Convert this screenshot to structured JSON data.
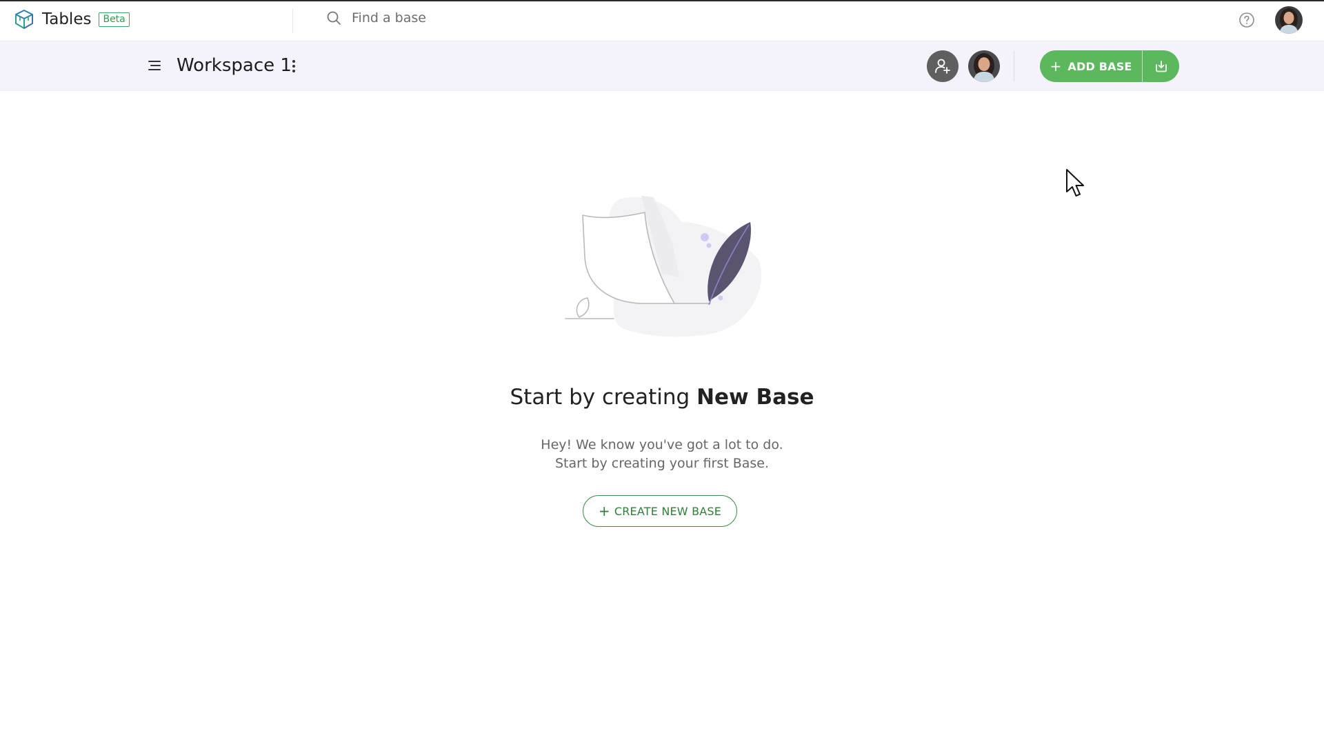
{
  "app": {
    "name": "Tables",
    "badge": "Beta",
    "accent": "#5bb85d"
  },
  "search": {
    "placeholder": "Find a base",
    "value": ""
  },
  "icons": {
    "logo": "cube-logo-icon",
    "search": "search-icon",
    "help": "help-circle-icon",
    "menu": "hamburger-menu-icon",
    "more": "vertical-dots-icon",
    "invite": "add-user-icon",
    "import": "download-import-icon",
    "cursor": "mouse-cursor-icon"
  },
  "workspace": {
    "title": "Workspace 1"
  },
  "toolbar": {
    "add_base_plus": "+",
    "add_base_label": "ADD BASE"
  },
  "empty_state": {
    "title_prefix": "Start by creating ",
    "title_bold": "New Base",
    "line1": "Hey! We know you've got a lot to do.",
    "line2": "Start by creating your first Base.",
    "button_plus": "+",
    "button_label": "CREATE NEW BASE"
  }
}
